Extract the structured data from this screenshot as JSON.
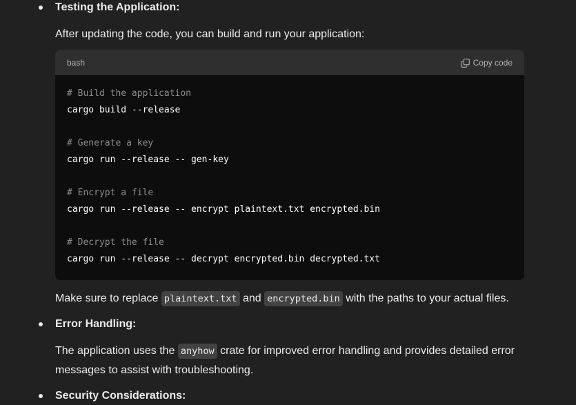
{
  "sections": [
    {
      "title": "Testing the Application:"
    },
    {
      "title": "Error Handling:"
    },
    {
      "title": "Security Considerations:"
    }
  ],
  "testing": {
    "intro": "After updating the code, you can build and run your application:",
    "after_before": "Make sure to replace ",
    "after_code1": "plaintext.txt",
    "after_mid": " and ",
    "after_code2": "encrypted.bin",
    "after_end": " with the paths to your actual files."
  },
  "code_block": {
    "language": "bash",
    "copy_label": "Copy code",
    "copy_icon": "copy-icon",
    "lines": [
      {
        "text": "# Build the application",
        "kind": "comment"
      },
      {
        "text": "cargo build --release",
        "kind": "command"
      },
      {
        "text": "# Generate a key",
        "kind": "comment"
      },
      {
        "text": "cargo run --release -- gen-key",
        "kind": "command"
      },
      {
        "text": "# Encrypt a file",
        "kind": "comment"
      },
      {
        "text": "cargo run --release -- encrypt plaintext.txt encrypted.bin",
        "kind": "command"
      },
      {
        "text": "# Decrypt the file",
        "kind": "comment"
      },
      {
        "text": "cargo run --release -- decrypt encrypted.bin decrypted.txt",
        "kind": "command"
      }
    ]
  },
  "error_handling": {
    "line1_before": "The application uses the ",
    "line1_code": "anyhow",
    "line1_after": " crate for improved error handling and provides detailed error",
    "line2": "messages to assist with troubleshooting."
  },
  "colors": {
    "background": "#212121",
    "code_background": "#0d0d0d",
    "code_header": "#2f2f2f",
    "inline_code_background": "#424242",
    "text": "#ececec",
    "comment": "#8d8d8d"
  }
}
